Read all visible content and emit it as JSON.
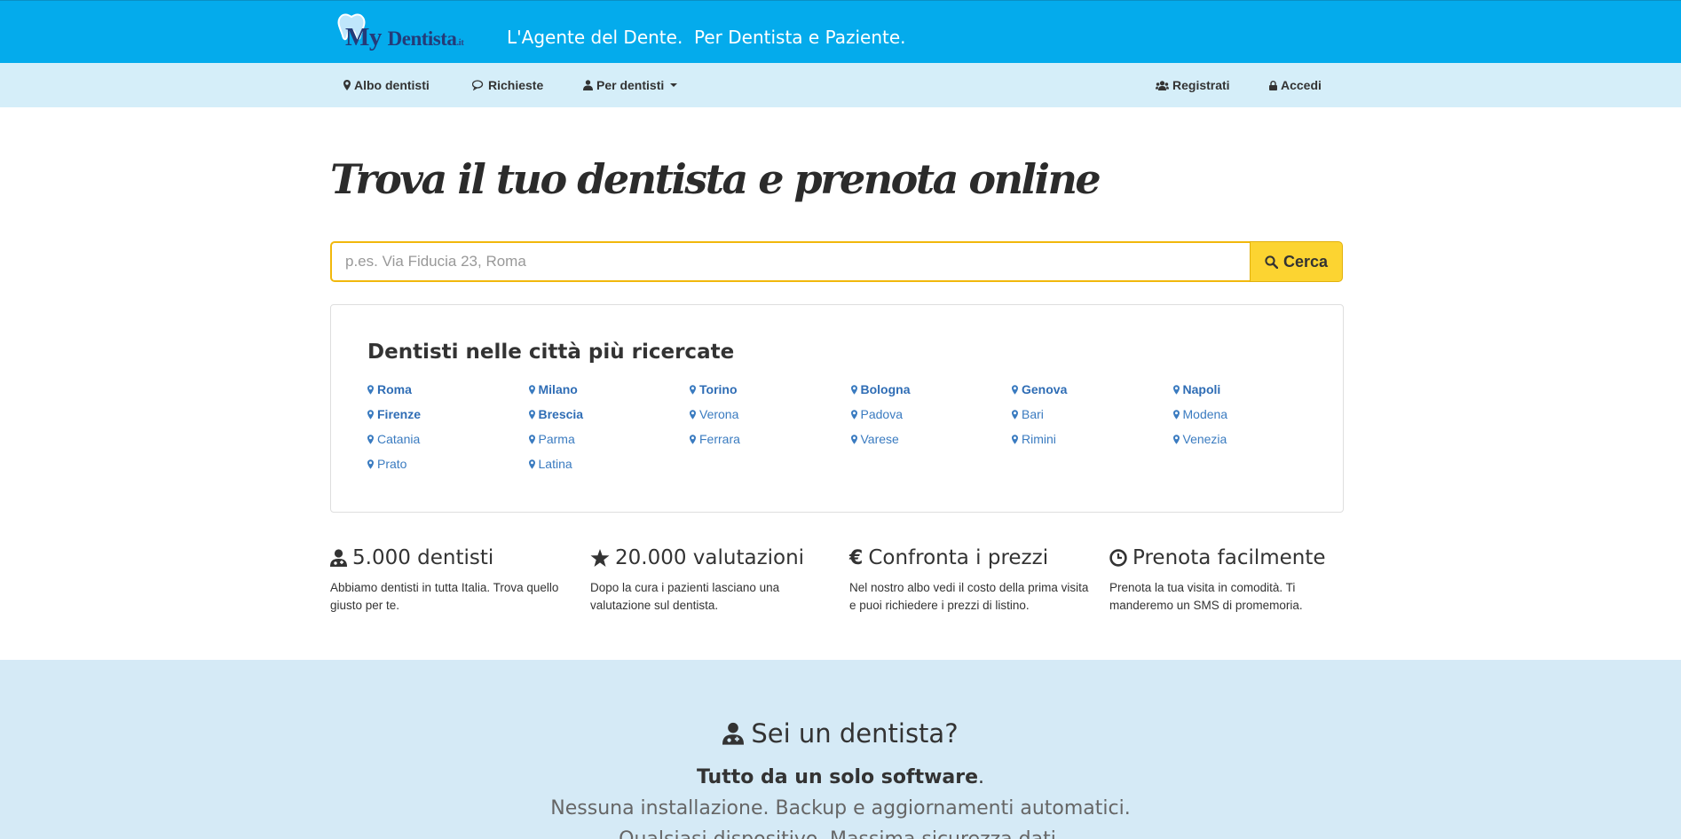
{
  "header": {
    "logo": {
      "my": "My",
      "dentista": "Dentista",
      "tld": ".it"
    },
    "tagline": "L'Agente del Dente.  Per Dentista e Paziente."
  },
  "nav": {
    "left": [
      {
        "label": "Albo dentisti",
        "icon": "map-marker-icon"
      },
      {
        "label": "Richieste",
        "icon": "comments-icon"
      },
      {
        "label": "Per dentisti",
        "icon": "user-md-icon",
        "dropdown": true
      }
    ],
    "right": [
      {
        "label": "Registrati",
        "icon": "users-icon"
      },
      {
        "label": "Accedi",
        "icon": "lock-icon"
      }
    ]
  },
  "hero": {
    "title": "Trova il tuo dentista e prenota online",
    "search_placeholder": "p.es. Via Fiducia 23, Roma",
    "search_value": "",
    "search_button": "Cerca"
  },
  "cities": {
    "title": "Dentisti nelle città più ricercate",
    "items": [
      {
        "name": "Roma",
        "bold": true
      },
      {
        "name": "Milano",
        "bold": true
      },
      {
        "name": "Torino",
        "bold": true
      },
      {
        "name": "Bologna",
        "bold": true
      },
      {
        "name": "Genova",
        "bold": true
      },
      {
        "name": "Napoli",
        "bold": true
      },
      {
        "name": "Firenze",
        "bold": true
      },
      {
        "name": "Brescia",
        "bold": true
      },
      {
        "name": "Verona",
        "bold": false
      },
      {
        "name": "Padova",
        "bold": false
      },
      {
        "name": "Bari",
        "bold": false
      },
      {
        "name": "Modena",
        "bold": false
      },
      {
        "name": "Catania",
        "bold": false
      },
      {
        "name": "Parma",
        "bold": false
      },
      {
        "name": "Ferrara",
        "bold": false
      },
      {
        "name": "Varese",
        "bold": false
      },
      {
        "name": "Rimini",
        "bold": false
      },
      {
        "name": "Venezia",
        "bold": false
      },
      {
        "name": "Prato",
        "bold": false
      },
      {
        "name": "Latina",
        "bold": false
      }
    ]
  },
  "features": [
    {
      "icon": "user-md-icon",
      "title": "5.000 dentisti",
      "desc": "Abbiamo dentisti in tutta Italia. Trova quello giusto per te."
    },
    {
      "icon": "star-icon",
      "title": "20.000 valutazioni",
      "desc": "Dopo la cura i pazienti lasciano una valutazione sul dentista."
    },
    {
      "icon": "euro-icon",
      "title": "Confronta i prezzi",
      "desc": "Nel nostro albo vedi il costo della prima visita e puoi richiedere i prezzi di listino."
    },
    {
      "icon": "clock-icon",
      "title": "Prenota facilmente",
      "desc": "Prenota la tua visita in comodità. Ti manderemo un SMS di promemoria."
    }
  ],
  "dentist_section": {
    "title": "Sei un dentista?",
    "line1_bold": "Tutto da un solo software",
    "line1_rest": ".",
    "line2": "Nessuna installazione. Backup e aggiornamenti automatici.",
    "line3": "Qualsiasi dispositivo. Massima sicurezza dati."
  },
  "colors": {
    "topbar": "#04abec",
    "navbar": "#d5eef9",
    "accent_button": "#fcd431",
    "link": "#3a7bc0",
    "section_bg": "#d5eaf6"
  }
}
